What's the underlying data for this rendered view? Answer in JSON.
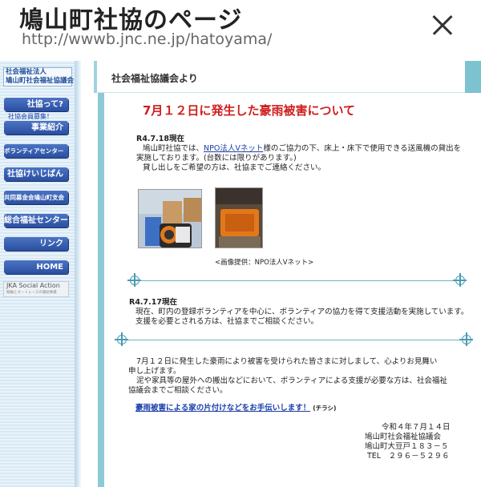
{
  "header": {
    "title": "鳩山町社協のページ",
    "url": "http://wwwb.jnc.ne.jp/hatoyama/"
  },
  "sidebar": {
    "logo_line1": "社会福祉法人",
    "logo_line2": "鳩山町社会福祉協議会",
    "items": [
      {
        "label": "社協って?"
      },
      {
        "label": "社協会員募集！"
      },
      {
        "label": "事業紹介"
      },
      {
        "label": "ボランティアセンター"
      },
      {
        "label": "社協けいじばん"
      },
      {
        "label": "共同募金会鳩山町支会"
      },
      {
        "label": "総合福祉センター"
      },
      {
        "label": "リンク"
      },
      {
        "label": "HOME"
      }
    ],
    "jka_title": "JKA Social Action",
    "jka_sub": "競輪とオートレースの補助事業"
  },
  "content": {
    "section_label": "社会福祉協議会より",
    "headline": "7月１２日に発生した豪雨被害について",
    "update1": {
      "date": "R4.7.18現在",
      "line1_a": "鳩山町社協では、",
      "line1_link": "NPO法人Vネット",
      "line1_b": "様のご協力の下、床上・床下で使用できる送風機の貸出を",
      "line2": "実施しております。(台数には限りがあります。)",
      "line3": "貸し出しをご希望の方は、社協までご連絡ください。",
      "photo_caption": "<画像提供：NPO法人Vネット>"
    },
    "update2": {
      "date": "R4.7.17現在",
      "line1": "現在、町内の登録ボランティアを中心に、ボランティアの協力を得て支援活動を実施しています。",
      "line2": "支援を必要とされる方は、社協までご相談ください。"
    },
    "message": {
      "line1": "7月１２日に発生した豪雨により被害を受けられた皆さまに対しまして、心よりお見舞い",
      "line2": "申し上げます。",
      "line3": "泥や家具等の屋外への搬出などにおいて、ボランティアによる支援が必要な方は、社会福祉",
      "line4": "協議会までご相談ください。"
    },
    "flyer_link": "豪雨被害による家の片付けなどをお手伝いします！",
    "flyer_note": "(チラシ)",
    "signature": {
      "date": "令和４年７月１４日",
      "org": "鳩山町社会福祉協議会",
      "address": "鳩山町大豆戸１８３－５",
      "tel": "TEL　２９６－５２９６"
    }
  },
  "colors": {
    "accent_teal": "#8ccad4",
    "headline_red": "#d01c1c",
    "nav_blue": "#2a4fa0",
    "link_blue": "#1a3ea8"
  }
}
